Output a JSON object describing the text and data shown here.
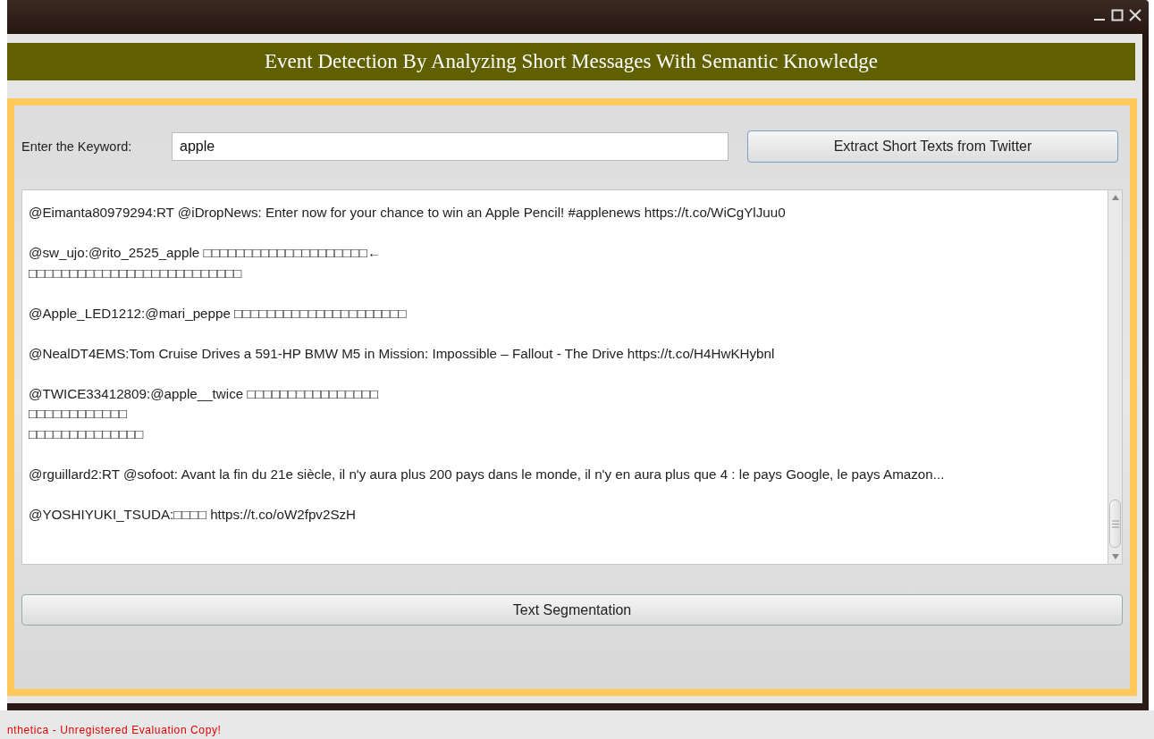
{
  "header": {
    "title": "Event Detection By Analyzing Short Messages With Semantic Knowledge"
  },
  "keyword": {
    "label": "Enter the Keyword:",
    "value": "apple"
  },
  "extract_button": "Extract Short Texts from Twitter",
  "messages": [
    {
      "lines": [
        "@Eimanta80979294:RT @iDropNews: Enter now for your chance to win an Apple Pencil! #applenews https://t.co/WiCgYlJuu0"
      ]
    },
    {
      "lines": [
        "@sw_ujo:@rito_2525_apple □□□□□□□□□□□□□□□□□□□□←",
        "□□□□□□□□□□□□□□□□□□□□□□□□□□"
      ]
    },
    {
      "lines": [
        "@Apple_LED1212:@mari_peppe □□□□□□□□□□□□□□□□□□□□□"
      ]
    },
    {
      "lines": [
        "@NealDT4EMS:Tom Cruise Drives a 591-HP BMW M5 in Mission: Impossible – Fallout - The Drive https://t.co/H4HwKHybnl"
      ]
    },
    {
      "lines": [
        "@TWICE33412809:@apple__twice □□□□□□□□□□□□□□□□",
        "□□□□□□□□□□□□",
        "□□□□□□□□□□□□□□"
      ]
    },
    {
      "lines": [
        "@rguillard2:RT @sofoot: Avant la fin du 21e siècle, il n'y aura plus 200 pays dans le monde, il n'y en aura plus que 4 : le pays Google, le pays Amazon..."
      ]
    },
    {
      "lines": [
        "@YOSHIYUKI_TSUDA:□□□□ https://t.co/oW2fpv2SzH"
      ]
    }
  ],
  "segment_button": "Text Segmentation",
  "license_notice": "nthetica - Unregistered Evaluation Copy!"
}
